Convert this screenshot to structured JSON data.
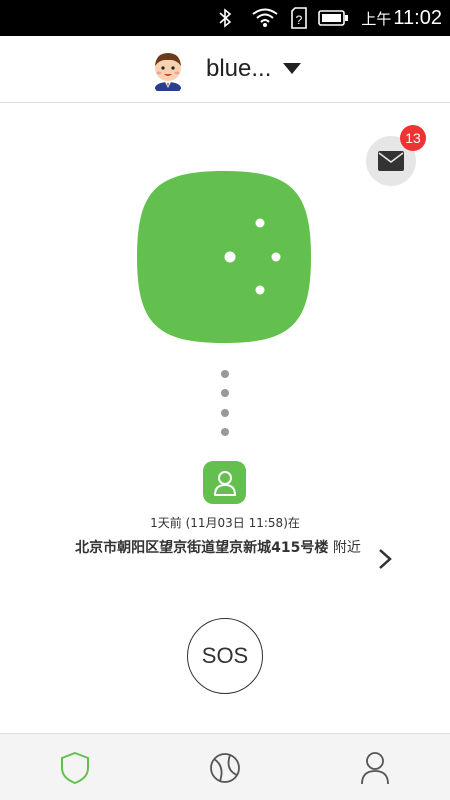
{
  "status_bar": {
    "ampm": "上午",
    "time": "11:02",
    "icons": [
      "bluetooth-icon",
      "wifi-icon",
      "sim-unknown-icon",
      "battery-icon"
    ]
  },
  "header": {
    "account_name": "blue...",
    "avatar_icon": "child-avatar",
    "dropdown_icon": "caret-down-icon"
  },
  "mail": {
    "icon": "envelope-icon",
    "badge_count": "13"
  },
  "device": {
    "tile_icon": "device-dots-icon",
    "connector_icon": "vertical-dots"
  },
  "location": {
    "last_seen": "1天前 (11月03日 11:58)在",
    "address_bold": "北京市朝阳区望京街道望京新城415号楼",
    "address_suffix": " 附近"
  },
  "sos": {
    "label": "SOS"
  },
  "bottom_nav": {
    "items": [
      {
        "icon": "shield-icon",
        "active": true
      },
      {
        "icon": "ball-icon",
        "active": false
      },
      {
        "icon": "person-icon",
        "active": false
      }
    ]
  },
  "colors": {
    "accent_green": "#63c04f",
    "badge_red": "#ee3333",
    "status_bar": "#000000"
  }
}
